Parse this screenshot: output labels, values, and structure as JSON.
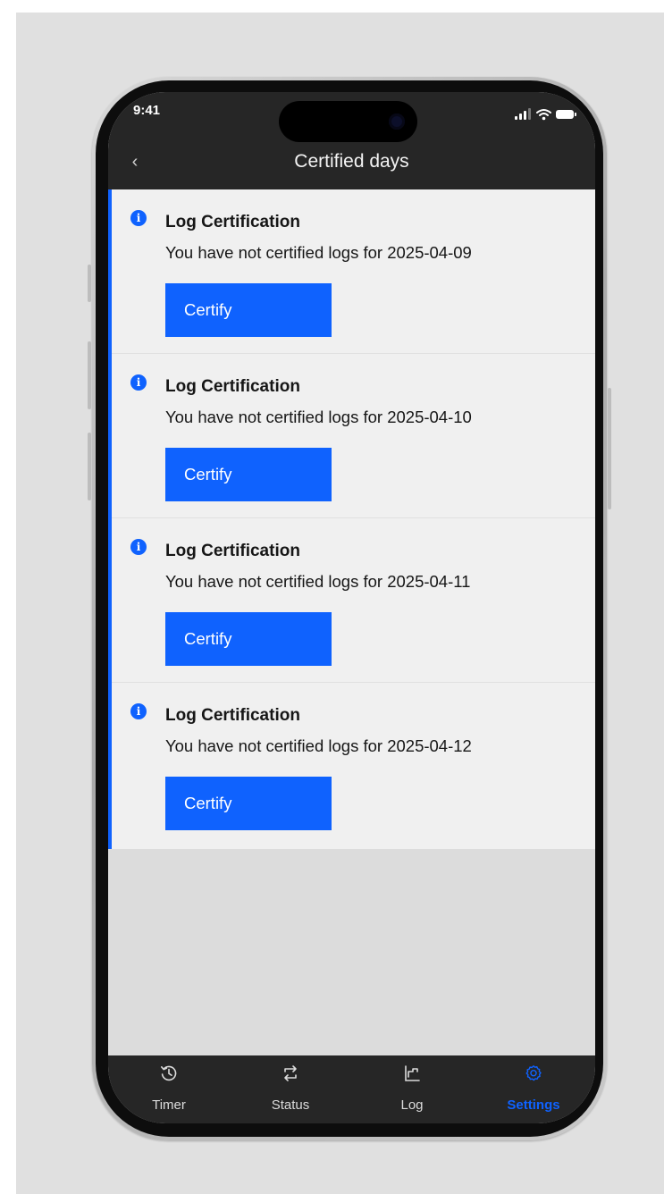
{
  "status_bar": {
    "time": "9:41"
  },
  "header": {
    "title": "Certified days",
    "back_label": "‹"
  },
  "notifications": [
    {
      "title": "Log Certification",
      "message": "You have not certified logs for 2025-04-09",
      "button_label": "Certify"
    },
    {
      "title": "Log Certification",
      "message": "You have not certified logs for 2025-04-10",
      "button_label": "Certify"
    },
    {
      "title": "Log Certification",
      "message": "You have not certified logs for 2025-04-11",
      "button_label": "Certify"
    },
    {
      "title": "Log Certification",
      "message": "You have not certified logs for 2025-04-12",
      "button_label": "Certify"
    }
  ],
  "tabbar": {
    "tabs": [
      {
        "label": "Timer",
        "icon": "history-icon",
        "active": false
      },
      {
        "label": "Status",
        "icon": "switch-arrows-icon",
        "active": false
      },
      {
        "label": "Log",
        "icon": "log-chart-icon",
        "active": false
      },
      {
        "label": "Settings",
        "icon": "gear-icon",
        "active": true
      }
    ]
  },
  "colors": {
    "accent": "#0f62fe",
    "header_bg": "#262626",
    "card_bg": "#f0f0f0",
    "text": "#161616",
    "info_icon_glyph": "i"
  }
}
